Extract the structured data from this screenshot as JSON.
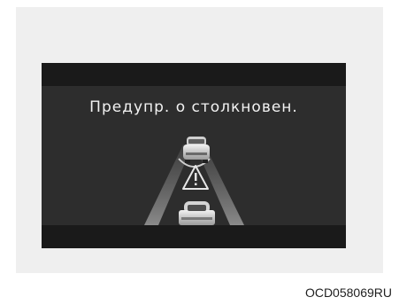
{
  "display": {
    "message": "Предупр. о столкновен."
  },
  "icons": {
    "lead_vehicle": "car-rear-icon",
    "warning": "warning-triangle-icon",
    "own_vehicle": "car-rear-icon"
  },
  "colors": {
    "screen_background": "#2d2d2d",
    "screen_band": "#1a1a1a",
    "text": "#f2f2f2",
    "page_panel": "#efefef"
  },
  "figure": {
    "code": "OCD058069RU"
  }
}
